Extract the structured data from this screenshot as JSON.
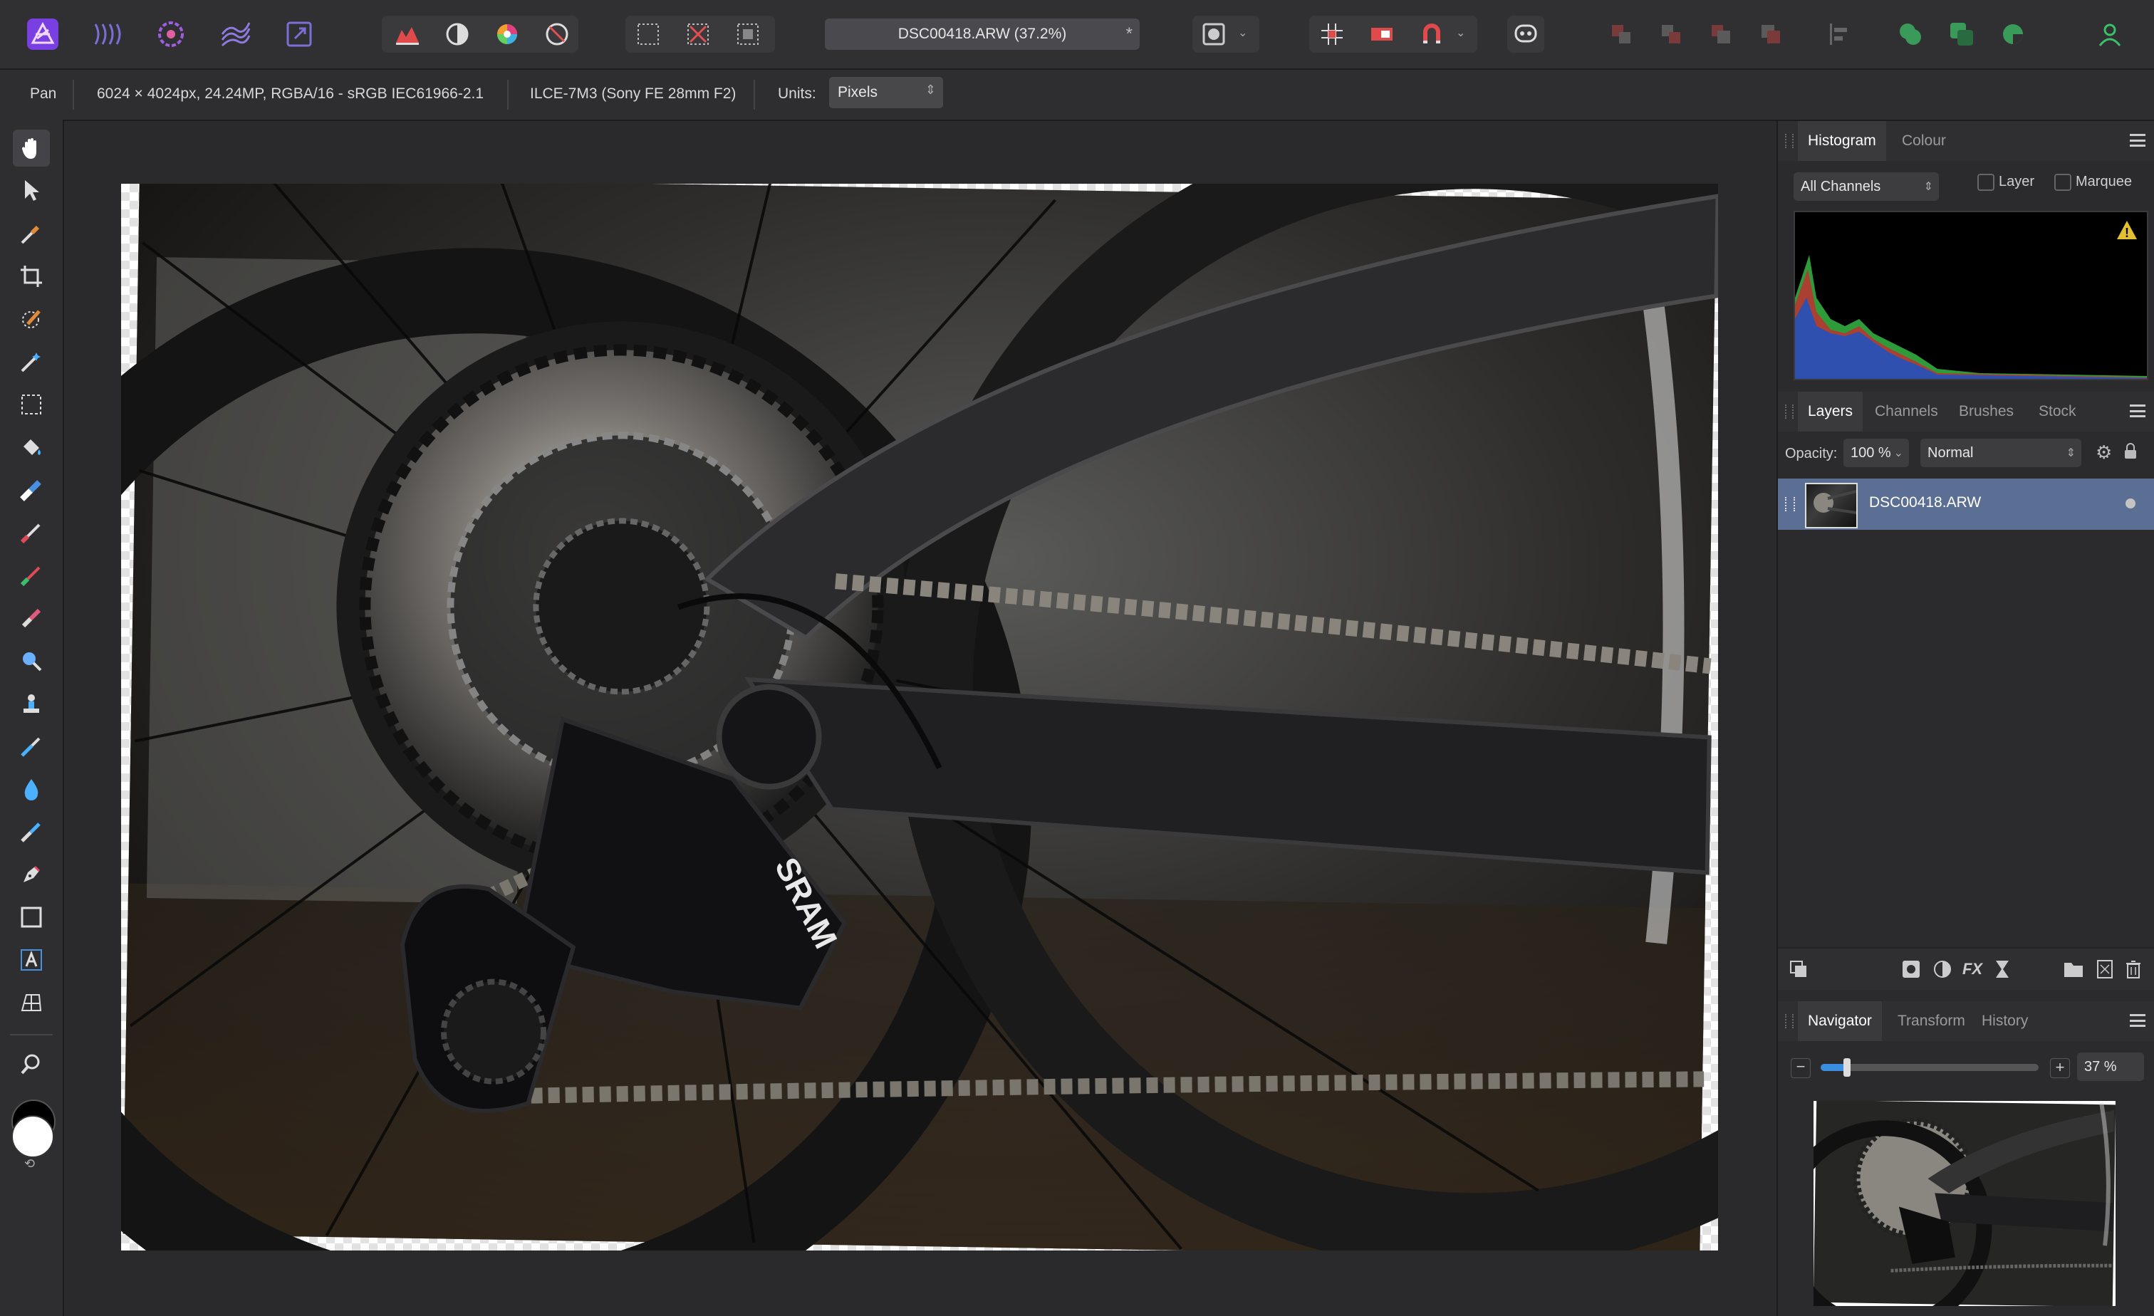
{
  "toolbar": {
    "document_tab": "DSC00418.ARW (37.2%)",
    "unsaved_marker": "*",
    "personas": [
      "photo-persona-icon",
      "liquify-persona-icon",
      "develop-persona-icon",
      "tone-mapping-persona-icon",
      "export-persona-icon"
    ],
    "colors": {
      "accent": "#8a4fff",
      "active_layer": "#5b6e93"
    }
  },
  "context": {
    "tool": "Pan",
    "image_info": "6024 × 4024px, 24.24MP, RGBA/16 - sRGB IEC61966-2.1",
    "camera": "ILCE-7M3 (Sony FE 28mm F2)",
    "units_label": "Units:",
    "units_value": "Pixels"
  },
  "histogram_panel": {
    "tabs": [
      "Histogram",
      "Colour"
    ],
    "channels_value": "All Channels",
    "layer_label": "Layer",
    "marquee_label": "Marquee"
  },
  "layers_panel": {
    "tabs": [
      "Layers",
      "Channels",
      "Brushes",
      "Stock"
    ],
    "opacity_label": "Opacity:",
    "opacity_value": "100 %",
    "blend_mode": "Normal",
    "layers": [
      {
        "name": "DSC00418.ARW"
      }
    ]
  },
  "navigator_panel": {
    "tabs": [
      "Navigator",
      "Transform",
      "History"
    ],
    "zoom_value": "37 %",
    "zoom_fraction": 0.12
  }
}
